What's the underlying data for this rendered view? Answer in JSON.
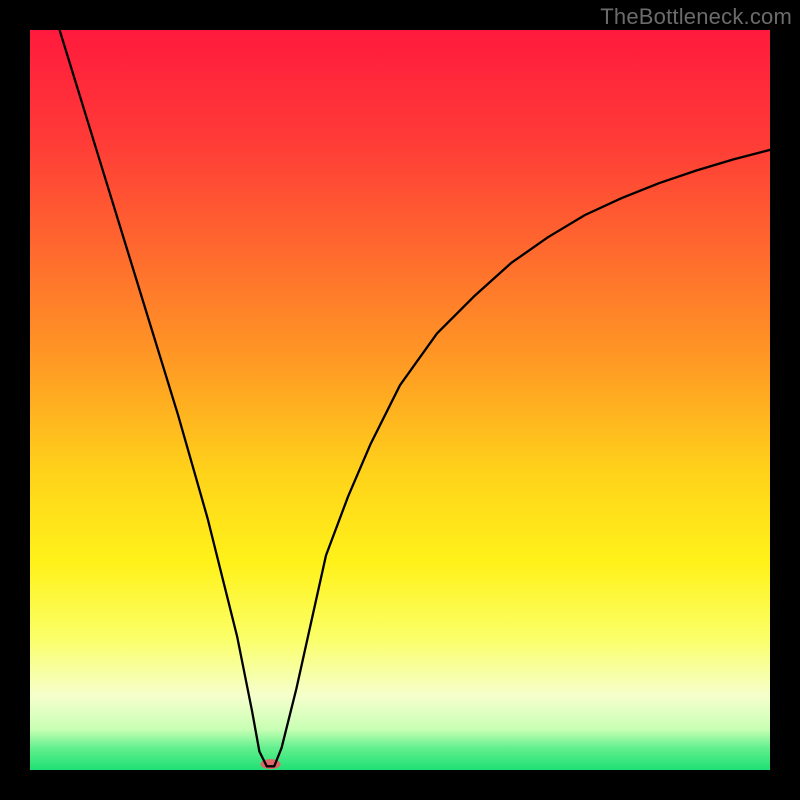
{
  "watermark": "TheBottleneck.com",
  "chart_data": {
    "type": "line",
    "title": "",
    "xlabel": "",
    "ylabel": "",
    "xlim": [
      0,
      100
    ],
    "ylim": [
      0,
      100
    ],
    "grid": false,
    "legend": false,
    "background_gradient_stops": [
      {
        "offset": 0.0,
        "color": "#ff1a3d"
      },
      {
        "offset": 0.15,
        "color": "#ff3b37"
      },
      {
        "offset": 0.3,
        "color": "#ff6a2e"
      },
      {
        "offset": 0.45,
        "color": "#ff9a24"
      },
      {
        "offset": 0.6,
        "color": "#ffd31a"
      },
      {
        "offset": 0.72,
        "color": "#fff21a"
      },
      {
        "offset": 0.82,
        "color": "#fbff66"
      },
      {
        "offset": 0.9,
        "color": "#f5ffcd"
      },
      {
        "offset": 0.945,
        "color": "#c8ffb4"
      },
      {
        "offset": 0.97,
        "color": "#63f08e"
      },
      {
        "offset": 1.0,
        "color": "#1fe074"
      }
    ],
    "series": [
      {
        "name": "curve",
        "color": "#000000",
        "stroke_width": 2.3,
        "x": [
          4,
          6,
          8,
          10,
          12,
          14,
          16,
          18,
          20,
          22,
          24,
          26,
          28,
          30,
          31,
          32,
          33,
          34,
          36,
          38,
          40,
          43,
          46,
          50,
          55,
          60,
          65,
          70,
          75,
          80,
          85,
          90,
          95,
          100
        ],
        "values": [
          100,
          93.5,
          87,
          80.5,
          74,
          67.5,
          61,
          54.5,
          48,
          41,
          34,
          26,
          18,
          8,
          2.5,
          0.5,
          0.5,
          3,
          11,
          20,
          29,
          37,
          44,
          52,
          59,
          64,
          68.5,
          72,
          75,
          77.3,
          79.3,
          81,
          82.5,
          83.8
        ]
      }
    ],
    "marker": {
      "name": "min-marker",
      "color": "#e06666",
      "x": 32.5,
      "y": 0.8,
      "rx": 10,
      "ry": 5
    }
  }
}
